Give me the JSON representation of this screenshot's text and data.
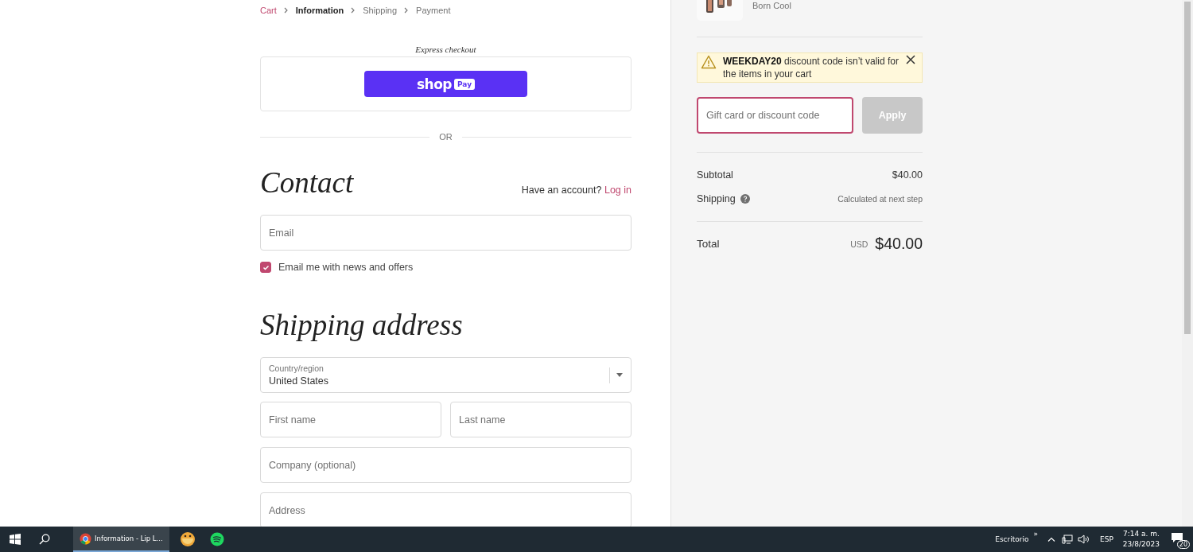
{
  "breadcrumb": [
    {
      "label": "Cart",
      "kind": "link"
    },
    {
      "label": "Information",
      "kind": "current"
    },
    {
      "label": "Shipping",
      "kind": "step"
    },
    {
      "label": "Payment",
      "kind": "step"
    }
  ],
  "express": {
    "title": "Express checkout",
    "brand": "shop",
    "badge": "Pay"
  },
  "divider_label": "OR",
  "contact": {
    "heading": "Contact",
    "account_prompt": "Have an account?",
    "login": "Log in",
    "email_placeholder": "Email",
    "newsletter": {
      "label": "Email me with news and offers",
      "checked": true
    }
  },
  "shipping_address": {
    "heading": "Shipping address",
    "country": {
      "label": "Country/region",
      "value": "United States"
    },
    "fields": [
      {
        "placeholder": "First name",
        "kind": "half"
      },
      {
        "placeholder": "Last name",
        "kind": "half"
      },
      {
        "placeholder": "Company (optional)",
        "kind": "full"
      },
      {
        "placeholder": "Address",
        "kind": "full"
      }
    ]
  },
  "summary": {
    "product": {
      "variant": "Born Cool"
    },
    "alert": {
      "code": "WEEKDAY20",
      "message": "discount code isn’t valid for the items in your cart"
    },
    "discount": {
      "placeholder": "Gift card or discount code",
      "button": "Apply",
      "button_disabled": true
    },
    "lines": [
      {
        "label": "Subtotal",
        "value": "$40.00",
        "kind": "plain"
      },
      {
        "label": "Shipping",
        "value": "Calculated at next step",
        "kind": "help"
      }
    ],
    "total": {
      "label": "Total",
      "currency": "USD",
      "value": "$40.00"
    }
  },
  "taskbar": {
    "window": "Information - Lip L...",
    "desktop": "Escritorio",
    "overflow": "»",
    "language": "ESP",
    "time": "7:14 a. m.",
    "date": "23/8/2023",
    "notifications": "20"
  }
}
